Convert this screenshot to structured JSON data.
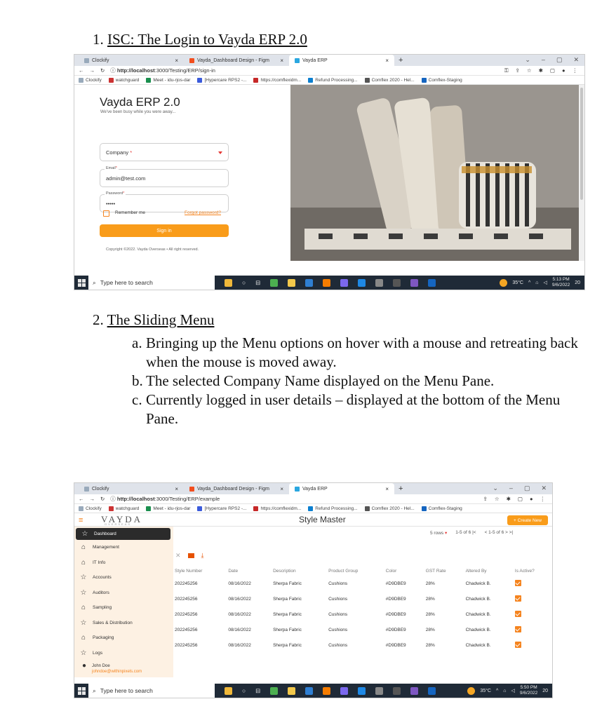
{
  "section1": {
    "number": "1.",
    "title": "ISC: The Login to Vayda ERP 2.0"
  },
  "section2": {
    "number": "2.",
    "title": "The Sliding Menu",
    "items": [
      {
        "marker": "a.",
        "text": "Bringing up the Menu options on hover with a mouse and retreating back when the mouse is moved away."
      },
      {
        "marker": "b.",
        "text": "The selected Company Name displayed on the Menu Pane."
      },
      {
        "marker": "c.",
        "text": "Currently logged in user details – displayed at the bottom of the Menu Pane."
      }
    ]
  },
  "browser": {
    "tabs": [
      "Clockify",
      "Vayda_Dashboard Design - Figm",
      "Vayda ERP"
    ],
    "url1_host": "http://localhost",
    "url1_path": ":3000/Testing/ERP/sign-in",
    "url2_host": "http://localhost",
    "url2_path": ":3000/Testing/ERP/example",
    "bookmarks": [
      "Clockify",
      "watchguard",
      "Meet - idu-rjos-dar",
      "[Hypercare RPS2 -...",
      "https://comflexidm...",
      "Refund Processing...",
      "Comflex 2020 - Hel...",
      "Comflex-Staging"
    ]
  },
  "taskbar": {
    "search": "Type here to search",
    "temp": "35°C",
    "time1": "5:13 PM",
    "date1": "9/6/2022",
    "time2": "5:50 PM",
    "date2": "9/6/2022",
    "notif": "20"
  },
  "login": {
    "title": "Vayda ERP 2.0",
    "tagline": "We've been busy while you were away...",
    "company_placeholder": "Company",
    "email_label": "Email",
    "email_value": "admin@test.com",
    "password_label": "Password",
    "password_value": "•••••",
    "remember": "Remember me",
    "forgot": "Forgot password?",
    "signin": "Sign in",
    "copyright": "Copyright ©2022. Vayda Overseas • All right reserved."
  },
  "app": {
    "logo": "VAYDA",
    "logo_sub": "OVERSEAS",
    "page_title": "Style Master",
    "create_button": "+ Create New",
    "rows_label": "5 rows",
    "pager1": "1-5 of 6 |<",
    "pager2": "< 1-5 of 6 > >|",
    "menu": [
      "Dashboard",
      "Management",
      "IT Info",
      "Accounts",
      "Auditors",
      "Sampling",
      "Sales & Distribution",
      "Packaging",
      "Logs"
    ],
    "user_name": "John Doe",
    "user_email": "johndoe@withinpixels.com",
    "table": {
      "headers": [
        "Style Number",
        "Date",
        "Description",
        "Product Group",
        "Color",
        "GST Rate",
        "Altered By",
        "Is Active?"
      ],
      "rows": [
        [
          "202245256",
          "08/16/2022",
          "Sherpa Fabric",
          "Cushions",
          "#D9DBE9",
          "28%",
          "Chadwick B."
        ],
        [
          "202245256",
          "08/16/2022",
          "Sherpa Fabric",
          "Cushions",
          "#D9DBE9",
          "28%",
          "Chadwick B."
        ],
        [
          "202245256",
          "08/16/2022",
          "Sherpa Fabric",
          "Cushions",
          "#D9DBE9",
          "28%",
          "Chadwick B."
        ],
        [
          "202245256",
          "08/16/2022",
          "Sherpa Fabric",
          "Cushions",
          "#D9DBE9",
          "28%",
          "Chadwick B."
        ],
        [
          "202245256",
          "08/16/2022",
          "Sherpa Fabric",
          "Cushions",
          "#D9DBE9",
          "28%",
          "Chadwick B."
        ]
      ]
    }
  },
  "colors": {
    "accent": "#F99C1A",
    "sidebar": "#FDF1E3",
    "taskbar": "#1F2A37"
  }
}
